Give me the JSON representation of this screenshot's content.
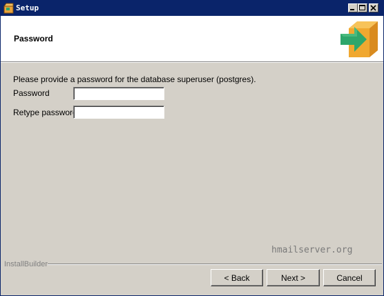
{
  "window": {
    "title": "Setup",
    "controls": {
      "minimize": "minimize-icon",
      "maximize": "maximize-icon",
      "close": "close-icon"
    }
  },
  "header": {
    "title": "Password",
    "icon": "installer-box-arrow-icon"
  },
  "form": {
    "description": "Please provide a password for the database superuser (postgres).",
    "password_label": "Password",
    "password_value": "",
    "retype_label": "Retype password",
    "retype_value": ""
  },
  "watermark": "hmailserver.org",
  "footer": {
    "brand": "InstallBuilder",
    "back_label": "< Back",
    "next_label": "Next >",
    "cancel_label": "Cancel"
  },
  "colors": {
    "titlebar": "#0a246a",
    "face": "#d4d0c8",
    "arrow": "#2ea66b",
    "box": "#f0a830"
  }
}
